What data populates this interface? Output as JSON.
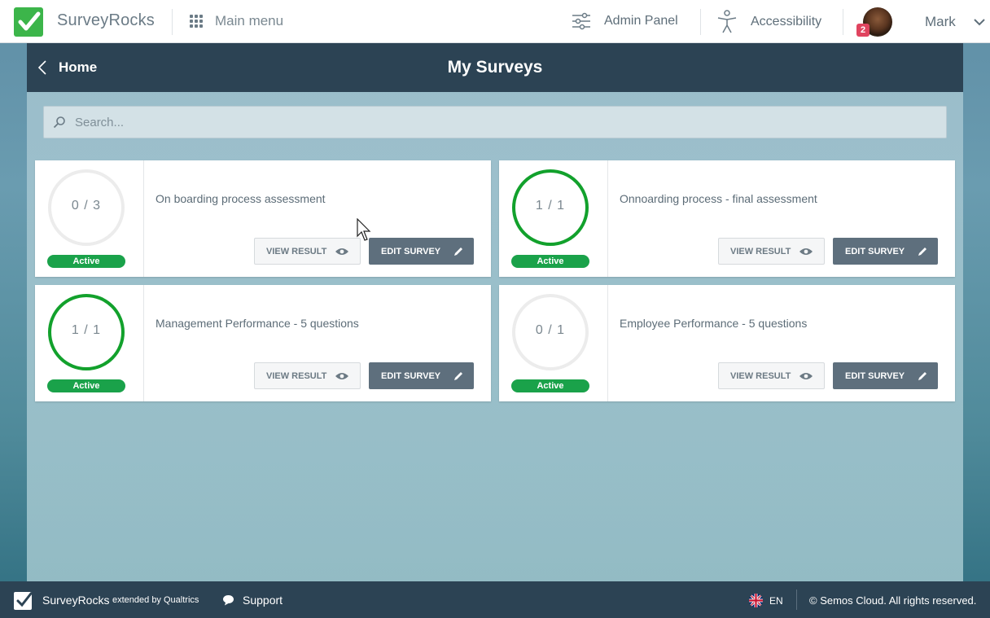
{
  "header": {
    "brand": "SurveyRocks",
    "main_menu": "Main menu",
    "admin_panel": "Admin Panel",
    "accessibility": "Accessibility",
    "user_name": "Mark",
    "notification_count": "2"
  },
  "panel": {
    "back_label": "Home",
    "title": "My Surveys",
    "search_placeholder": "Search..."
  },
  "surveys": [
    {
      "progress": "0 / 3",
      "completed": 0,
      "total": 3,
      "status": "Active",
      "title": "On boarding process assessment",
      "view_label": "VIEW RESULT",
      "edit_label": "EDIT SURVEY"
    },
    {
      "progress": "1 / 1",
      "completed": 1,
      "total": 1,
      "status": "Active",
      "title": "Onnoarding process - final assessment",
      "view_label": "VIEW RESULT",
      "edit_label": "EDIT SURVEY"
    },
    {
      "progress": "1 / 1",
      "completed": 1,
      "total": 1,
      "status": "Active",
      "title": "Management Performance - 5 questions",
      "view_label": "VIEW RESULT",
      "edit_label": "EDIT SURVEY"
    },
    {
      "progress": "0 / 1",
      "completed": 0,
      "total": 1,
      "status": "Active",
      "title": "Employee Performance - 5 questions",
      "view_label": "VIEW RESULT",
      "edit_label": "EDIT SURVEY"
    }
  ],
  "footer": {
    "brand": "SurveyRocks",
    "extended": "extended by Qualtrics",
    "support": "Support",
    "language": "EN",
    "copyright": "© Semos Cloud. All rights reserved."
  },
  "colors": {
    "accent_green": "#1aa24a",
    "dark_header": "#2c4354",
    "edit_button": "#5e6f7d"
  }
}
